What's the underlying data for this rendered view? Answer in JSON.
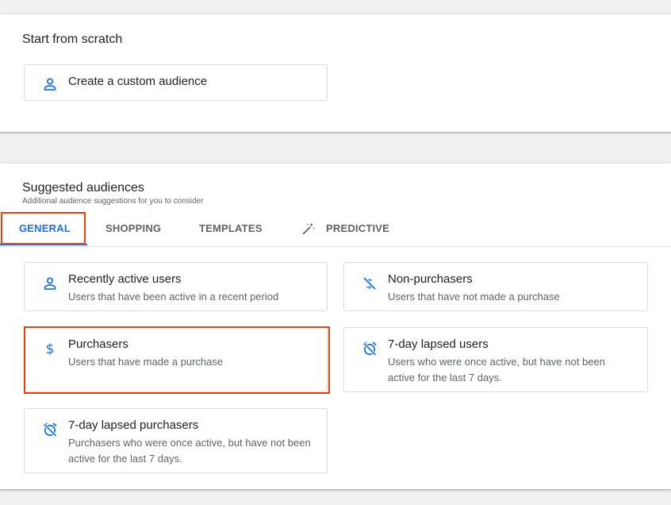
{
  "scratch": {
    "title": "Start from scratch",
    "create_label": "Create a custom audience"
  },
  "suggested": {
    "title": "Suggested audiences",
    "subtitle": "Additional audience suggestions for you to consider",
    "tabs": [
      {
        "label": "GENERAL",
        "active": true
      },
      {
        "label": "SHOPPING",
        "active": false
      },
      {
        "label": "TEMPLATES",
        "active": false
      },
      {
        "label": "PREDICTIVE",
        "active": false,
        "icon": "magic-wand-icon"
      }
    ],
    "cards": [
      {
        "title": "Recently active users",
        "description": "Users that have been active in a recent period",
        "icon": "person-icon"
      },
      {
        "title": "Non-purchasers",
        "description": "Users that have not made a purchase",
        "icon": "no-dollar-icon"
      },
      {
        "title": "Purchasers",
        "description": "Users that have made a purchase",
        "icon": "dollar-icon",
        "highlighted": true
      },
      {
        "title": "7-day lapsed users",
        "description": "Users who were once active, but have not been active for the last 7 days.",
        "icon": "alarm-off-icon"
      },
      {
        "title": "7-day lapsed purchasers",
        "description": "Purchasers who were once active, but have not been active for the last 7 days.",
        "icon": "alarm-off-icon"
      }
    ]
  },
  "colors": {
    "accent": "#1a73e8",
    "highlight": "#e8410c",
    "background": "#f1f1f1"
  }
}
